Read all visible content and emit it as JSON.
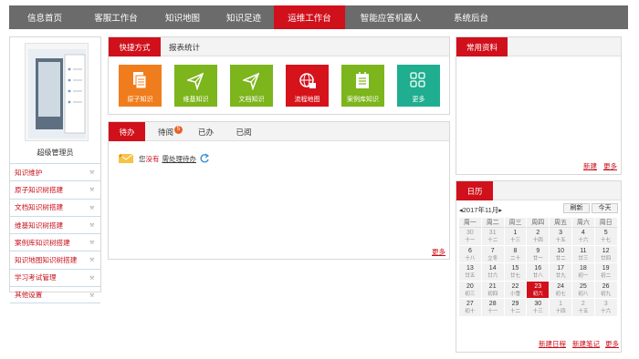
{
  "nav": {
    "items": [
      {
        "label": "信息首页"
      },
      {
        "label": "客服工作台"
      },
      {
        "label": "知识地图"
      },
      {
        "label": "知识足迹"
      },
      {
        "label": "运维工作台"
      },
      {
        "label": "智能应答机器人"
      },
      {
        "label": "系统后台"
      }
    ],
    "active_index": 4
  },
  "user": {
    "name": "超级管理员"
  },
  "menu": [
    {
      "label": "知识维护"
    },
    {
      "label": "原子知识树搭建"
    },
    {
      "label": "文档知识树搭建"
    },
    {
      "label": "维基知识树搭建"
    },
    {
      "label": "案例库知识树搭建"
    },
    {
      "label": "知识地图知识树搭建"
    },
    {
      "label": "学习考试管理"
    },
    {
      "label": "其他设置"
    }
  ],
  "quick": {
    "tab_active": "快捷方式",
    "tab_other": "报表统计",
    "tiles": [
      {
        "label": "原子知识",
        "color": "#f07d1d",
        "icon": "documents-icon"
      },
      {
        "label": "维基知识",
        "color": "#7cb51c",
        "icon": "paper-plane-icon"
      },
      {
        "label": "文档知识",
        "color": "#7cb51c",
        "icon": "paper-plane-icon"
      },
      {
        "label": "流程地图",
        "color": "#d6131b",
        "icon": "globe-icon"
      },
      {
        "label": "案例库知识",
        "color": "#7cb51c",
        "icon": "notebook-icon"
      },
      {
        "label": "更多",
        "color": "#1fae8f",
        "icon": "grid-icon"
      }
    ]
  },
  "todo": {
    "tabs": [
      {
        "label": "待办"
      },
      {
        "label": "待阅"
      },
      {
        "label": "已办"
      },
      {
        "label": "已阅"
      }
    ],
    "unread_count": "5",
    "msg_you": "您",
    "msg_none": "没有",
    "msg_link": "需处理待办",
    "more": "更多"
  },
  "resources": {
    "title": "常用资料",
    "new": "新建",
    "more": "更多"
  },
  "calendar": {
    "title": "日历",
    "month_label": "2017年11月",
    "refresh": "刷新",
    "today": "今天",
    "weekdays": [
      "周一",
      "周二",
      "周三",
      "周四",
      "周五",
      "周六",
      "周日"
    ],
    "weeks": [
      [
        {
          "d": "30",
          "l": "十一",
          "dim": true
        },
        {
          "d": "31",
          "l": "十二",
          "dim": true
        },
        {
          "d": "1",
          "l": "十三"
        },
        {
          "d": "2",
          "l": "十四"
        },
        {
          "d": "3",
          "l": "十五"
        },
        {
          "d": "4",
          "l": "十六"
        },
        {
          "d": "5",
          "l": "十七"
        }
      ],
      [
        {
          "d": "6",
          "l": "十八"
        },
        {
          "d": "7",
          "l": "立冬"
        },
        {
          "d": "8",
          "l": "二十"
        },
        {
          "d": "9",
          "l": "廿一"
        },
        {
          "d": "10",
          "l": "廿二"
        },
        {
          "d": "11",
          "l": "廿三"
        },
        {
          "d": "12",
          "l": "廿四"
        }
      ],
      [
        {
          "d": "13",
          "l": "廿五"
        },
        {
          "d": "14",
          "l": "廿六"
        },
        {
          "d": "15",
          "l": "廿七"
        },
        {
          "d": "16",
          "l": "廿八"
        },
        {
          "d": "17",
          "l": "廿九"
        },
        {
          "d": "18",
          "l": "初一"
        },
        {
          "d": "19",
          "l": "初二"
        }
      ],
      [
        {
          "d": "20",
          "l": "初三"
        },
        {
          "d": "21",
          "l": "初四"
        },
        {
          "d": "22",
          "l": "小雪"
        },
        {
          "d": "23",
          "l": "初六",
          "today": true
        },
        {
          "d": "24",
          "l": "初七"
        },
        {
          "d": "25",
          "l": "初八"
        },
        {
          "d": "26",
          "l": "初九"
        }
      ],
      [
        {
          "d": "27",
          "l": "初十"
        },
        {
          "d": "28",
          "l": "十一"
        },
        {
          "d": "29",
          "l": "十二"
        },
        {
          "d": "30",
          "l": "十三"
        },
        {
          "d": "1",
          "l": "十四",
          "dim": true
        },
        {
          "d": "2",
          "l": "十五",
          "dim": true
        },
        {
          "d": "3",
          "l": "十六",
          "dim": true
        }
      ]
    ],
    "new_schedule": "新建日程",
    "new_note": "新建笔记",
    "more": "更多"
  }
}
